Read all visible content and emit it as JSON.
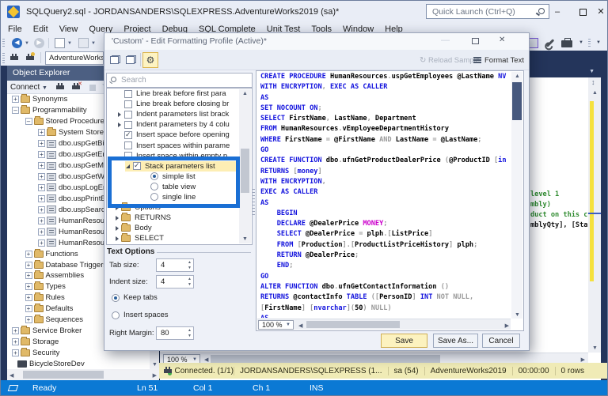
{
  "window": {
    "title": "SQLQuery2.sql - JORDANSANDERS\\SQLEXPRESS.AdventureWorks2019 (sa)*",
    "quick_launch_placeholder": "Quick Launch (Ctrl+Q)",
    "minimize": "–",
    "maximize": "",
    "close": "✕"
  },
  "menu": [
    "File",
    "Edit",
    "View",
    "Query",
    "Project",
    "Debug",
    "SQL Complete",
    "Unit Test",
    "Tools",
    "Window",
    "Help"
  ],
  "toolbar": {
    "db_combo": "AdventureWorks"
  },
  "object_explorer": {
    "title": "Object Explorer",
    "connect_label": "Connect",
    "tree": [
      {
        "label": "Synonyms",
        "lvl": 2,
        "exp": "+",
        "icon": "folder"
      },
      {
        "label": "Programmability",
        "lvl": 2,
        "exp": "-",
        "icon": "folder"
      },
      {
        "label": "Stored Procedures",
        "lvl": 3,
        "exp": "-",
        "icon": "folder"
      },
      {
        "label": "System Stored",
        "lvl": 4,
        "exp": "+",
        "icon": "folder"
      },
      {
        "label": "dbo.uspGetBil",
        "lvl": 4,
        "exp": "+",
        "icon": "sproc"
      },
      {
        "label": "dbo.uspGetEm",
        "lvl": 4,
        "exp": "+",
        "icon": "sproc"
      },
      {
        "label": "dbo.uspGetMa",
        "lvl": 4,
        "exp": "+",
        "icon": "sproc"
      },
      {
        "label": "dbo.uspGetWh",
        "lvl": 4,
        "exp": "+",
        "icon": "sproc"
      },
      {
        "label": "dbo.uspLogEr",
        "lvl": 4,
        "exp": "+",
        "icon": "sproc"
      },
      {
        "label": "dbo.uspPrintE",
        "lvl": 4,
        "exp": "+",
        "icon": "sproc"
      },
      {
        "label": "dbo.uspSearch",
        "lvl": 4,
        "exp": "+",
        "icon": "sproc"
      },
      {
        "label": "HumanResou",
        "lvl": 4,
        "exp": "+",
        "icon": "sproc"
      },
      {
        "label": "HumanResou",
        "lvl": 4,
        "exp": "+",
        "icon": "sproc"
      },
      {
        "label": "HumanResou",
        "lvl": 4,
        "exp": "+",
        "icon": "sproc"
      },
      {
        "label": "Functions",
        "lvl": 3,
        "exp": "+",
        "icon": "folder"
      },
      {
        "label": "Database Triggers",
        "lvl": 3,
        "exp": "+",
        "icon": "folder"
      },
      {
        "label": "Assemblies",
        "lvl": 3,
        "exp": "+",
        "icon": "folder"
      },
      {
        "label": "Types",
        "lvl": 3,
        "exp": "+",
        "icon": "folder"
      },
      {
        "label": "Rules",
        "lvl": 3,
        "exp": "+",
        "icon": "folder"
      },
      {
        "label": "Defaults",
        "lvl": 3,
        "exp": "+",
        "icon": "folder"
      },
      {
        "label": "Sequences",
        "lvl": 3,
        "exp": "+",
        "icon": "folder"
      },
      {
        "label": "Service Broker",
        "lvl": 2,
        "exp": "+",
        "icon": "folder"
      },
      {
        "label": "Storage",
        "lvl": 2,
        "exp": "+",
        "icon": "folder"
      },
      {
        "label": "Security",
        "lvl": 2,
        "exp": "+",
        "icon": "folder"
      },
      {
        "label": "BicycleStoreDev",
        "lvl": 1,
        "exp": null,
        "icon": "server"
      }
    ]
  },
  "dialog": {
    "title": "'Custom' - Edit Formatting Profile (Active)*",
    "reload_sample": "Reload Sample",
    "format_text": "Format Text",
    "search_placeholder": "Search",
    "tree": [
      {
        "t": "check",
        "label": "Line break before first para"
      },
      {
        "t": "check",
        "label": "Line break before closing br"
      },
      {
        "t": "check",
        "label": "Indent parameters list brack",
        "exp": true
      },
      {
        "t": "check",
        "label": "Indent parameters by 4 colu",
        "exp": true
      },
      {
        "t": "check",
        "label": "Insert space before opening",
        "checked": true
      },
      {
        "t": "check",
        "label": "Insert spaces within parame"
      },
      {
        "t": "check",
        "label": "Insert space within empty p"
      },
      {
        "t": "stack",
        "label": "Stack parameters list",
        "checked": true,
        "sel": true
      },
      {
        "t": "radio",
        "label": "simple list",
        "on": true
      },
      {
        "t": "radio",
        "label": "table view"
      },
      {
        "t": "radio",
        "label": "single line"
      },
      {
        "t": "folder",
        "label": "Options"
      },
      {
        "t": "folder",
        "label": "RETURNS"
      },
      {
        "t": "folder",
        "label": "Body"
      },
      {
        "t": "folder",
        "label": "SELECT"
      }
    ],
    "text_options": {
      "header": "Text Options",
      "tab_size_label": "Tab size:",
      "tab_size": "4",
      "indent_size_label": "Indent size:",
      "indent_size": "4",
      "keep_tabs": "Keep tabs",
      "insert_spaces": "Insert spaces",
      "right_margin_label": "Right Margin:",
      "right_margin": "80"
    },
    "zoom": "100 %",
    "buttons": {
      "save": "Save",
      "save_as": "Save As...",
      "cancel": "Cancel"
    }
  },
  "code": {
    "zoom": "100 %",
    "lines": [
      [
        [
          "k",
          "CREATE "
        ],
        [
          "k",
          "PROCEDURE "
        ],
        [
          "i",
          "HumanResources"
        ],
        [
          "o",
          "."
        ],
        [
          "i",
          "uspGetEmployees @LastName "
        ],
        [
          "k",
          "NV"
        ]
      ],
      [
        [
          "k",
          "WITH "
        ],
        [
          "k",
          "ENCRYPTION"
        ],
        [
          "o",
          ", "
        ],
        [
          "k",
          "EXEC "
        ],
        [
          "k",
          "AS "
        ],
        [
          "k",
          "CALLER"
        ]
      ],
      [
        [
          "k",
          "AS"
        ]
      ],
      [
        [
          "k",
          "SET "
        ],
        [
          "k",
          "NOCOUNT "
        ],
        [
          "k",
          "ON"
        ],
        [
          "o",
          ";"
        ]
      ],
      [
        [
          "k",
          "SELECT "
        ],
        [
          "i",
          "FirstName"
        ],
        [
          "o",
          ", "
        ],
        [
          "i",
          "LastName"
        ],
        [
          "o",
          ", "
        ],
        [
          "i",
          "Department"
        ]
      ],
      [
        [
          "k",
          "FROM "
        ],
        [
          "i",
          "HumanResources"
        ],
        [
          "o",
          "."
        ],
        [
          "i",
          "vEmployeeDepartmentHistory"
        ]
      ],
      [
        [
          "k",
          "WHERE "
        ],
        [
          "i",
          "FirstName "
        ],
        [
          "o",
          "= "
        ],
        [
          "i",
          "@FirstName "
        ],
        [
          "o",
          "AND "
        ],
        [
          "i",
          "LastName "
        ],
        [
          "o",
          "= "
        ],
        [
          "i",
          "@LastName"
        ],
        [
          "o",
          ";"
        ]
      ],
      [
        [
          "k",
          "GO"
        ]
      ],
      [
        [
          "k",
          "CREATE "
        ],
        [
          "k",
          "FUNCTION "
        ],
        [
          "i",
          "dbo"
        ],
        [
          "o",
          "."
        ],
        [
          "i",
          "ufnGetProductDealerPrice "
        ],
        [
          "o",
          "("
        ],
        [
          "i",
          "@ProductID "
        ],
        [
          "o",
          "["
        ],
        [
          "k",
          "in"
        ]
      ],
      [
        [
          "k",
          "RETURNS "
        ],
        [
          "o",
          "["
        ],
        [
          "k",
          "money"
        ],
        [
          "o",
          "]"
        ]
      ],
      [
        [
          "k",
          "WITH "
        ],
        [
          "k",
          "ENCRYPTION"
        ],
        [
          "o",
          ","
        ]
      ],
      [
        [
          "k",
          "EXEC "
        ],
        [
          "k",
          "AS "
        ],
        [
          "k",
          "CALLER"
        ]
      ],
      [
        [
          "k",
          "AS"
        ]
      ],
      [
        [
          "i",
          "    "
        ],
        [
          "k",
          "BEGIN"
        ]
      ],
      [
        [
          "i",
          "    "
        ],
        [
          "k",
          "DECLARE "
        ],
        [
          "i",
          "@DealerPrice "
        ],
        [
          "t",
          "MONEY"
        ],
        [
          "o",
          ";"
        ]
      ],
      [
        [
          "i",
          "    "
        ],
        [
          "k",
          "SELECT "
        ],
        [
          "i",
          "@DealerPrice "
        ],
        [
          "o",
          "= "
        ],
        [
          "i",
          "plph"
        ],
        [
          "o",
          ".["
        ],
        [
          "i",
          "ListPrice"
        ],
        [
          "o",
          "]"
        ]
      ],
      [
        [
          "i",
          "    "
        ],
        [
          "k",
          "FROM "
        ],
        [
          "o",
          "["
        ],
        [
          "i",
          "Production"
        ],
        [
          "o",
          "].["
        ],
        [
          "i",
          "ProductListPriceHistory"
        ],
        [
          "o",
          "] "
        ],
        [
          "i",
          "plph"
        ],
        [
          "o",
          ";"
        ]
      ],
      [
        [
          "i",
          "    "
        ],
        [
          "k",
          "RETURN "
        ],
        [
          "i",
          "@DealerPrice"
        ],
        [
          "o",
          ";"
        ]
      ],
      [
        [
          "i",
          "    "
        ],
        [
          "k",
          "END"
        ],
        [
          "o",
          ";"
        ]
      ],
      [
        [
          "k",
          "GO"
        ]
      ],
      [
        [
          "k",
          "ALTER "
        ],
        [
          "k",
          "FUNCTION "
        ],
        [
          "i",
          "dbo"
        ],
        [
          "o",
          "."
        ],
        [
          "i",
          "ufnGetContactInformation "
        ],
        [
          "o",
          "()"
        ]
      ],
      [
        [
          "k",
          "RETURNS "
        ],
        [
          "i",
          "@contactInfo "
        ],
        [
          "k",
          "TABLE "
        ],
        [
          "o",
          "(["
        ],
        [
          "i",
          "PersonID"
        ],
        [
          "o",
          "] "
        ],
        [
          "k",
          "INT "
        ],
        [
          "o",
          "NOT NULL,"
        ]
      ],
      [
        [
          "o",
          "["
        ],
        [
          "i",
          "FirstName"
        ],
        [
          "o",
          "] ["
        ],
        [
          "k",
          "nvarchar"
        ],
        [
          "o",
          "]("
        ],
        [
          "i",
          "50"
        ],
        [
          "o",
          ") "
        ],
        [
          "o",
          "NULL)"
        ]
      ],
      [
        [
          "k",
          "AS"
        ]
      ]
    ]
  },
  "editor_behind": {
    "lines": [
      {
        "c": "c-green",
        "text": "level 1"
      },
      {
        "c": "c-green",
        "text": "mbly)"
      },
      {
        "c": "c-green",
        "text": "duct on this c"
      },
      {
        "c": "c-blk",
        "text": "mblyQty], [Sta"
      }
    ],
    "zoom": "100 %"
  },
  "status_yellow": {
    "connected": "Connected. (1/1)",
    "right": [
      "JORDANSANDERS\\SQLEXPRESS (1...",
      "sa (54)",
      "AdventureWorks2019",
      "00:00:00",
      "0 rows"
    ]
  },
  "status_bar": {
    "ready": "Ready",
    "ln": "Ln 51",
    "col": "Col 1",
    "ch": "Ch 1",
    "ins": "INS"
  }
}
